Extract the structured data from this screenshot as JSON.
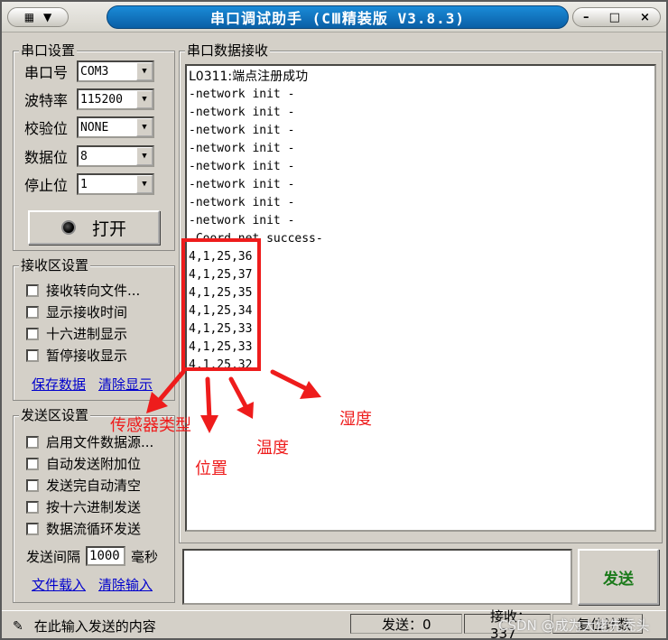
{
  "window": {
    "title": "串口调试助手 (CⅢ精装版 V3.8.3)",
    "controls": [
      "–",
      "□",
      "×"
    ]
  },
  "serial_settings": {
    "legend": "串口设置",
    "port": {
      "label": "串口号",
      "value": "COM3"
    },
    "baud": {
      "label": "波特率",
      "value": "115200"
    },
    "parity": {
      "label": "校验位",
      "value": "NONE"
    },
    "databits": {
      "label": "数据位",
      "value": "8"
    },
    "stopbits": {
      "label": "停止位",
      "value": "1"
    },
    "open_button": "打开"
  },
  "rx_settings": {
    "legend": "接收区设置",
    "options": [
      "接收转向文件...",
      "显示接收时间",
      "十六进制显示",
      "暂停接收显示"
    ],
    "save_link": "保存数据",
    "clear_link": "清除显示"
  },
  "tx_settings": {
    "legend": "发送区设置",
    "options": [
      "启用文件数据源...",
      "自动发送附加位",
      "发送完自动清空",
      "按十六进制发送",
      "数据流循环发送"
    ],
    "interval_label": "发送间隔",
    "interval_value": "1000",
    "interval_unit": "毫秒",
    "load_link": "文件载入",
    "clear_link": "清除输入"
  },
  "rx_panel": {
    "legend": "串口数据接收",
    "lines": [
      "L0311:端点注册成功",
      "-network init -",
      "-network init -",
      "-network init -",
      "-network init -",
      "-network init -",
      "-network init -",
      "-network init -",
      "-network init -",
      "-Coord net success-",
      "4,1,25,36",
      "4,1,25,37",
      "4,1,25,35",
      "4,1,25,34",
      "4,1,25,33",
      "4,1,25,33",
      "4,1,25,32"
    ]
  },
  "send_button": "发送",
  "status": {
    "hint": "在此输入发送的内容",
    "sent": "发送：0",
    "received": "接收：337",
    "reset": "复位计数"
  },
  "annotations": {
    "sensor_type": "传感器类型",
    "position": "位置",
    "temperature": "温度",
    "humidity": "湿度",
    "color": "#ee1c1c"
  },
  "watermark": "CSDN @成为大佬先秃头"
}
